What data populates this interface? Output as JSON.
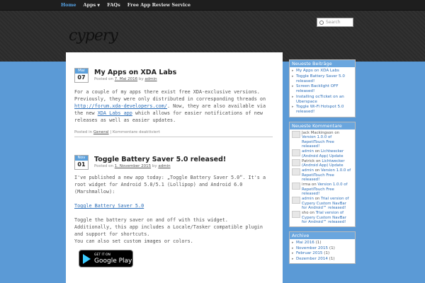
{
  "nav": {
    "home": "Home",
    "apps": "Apps",
    "faqs": "FAQs",
    "review": "Free App Review Service"
  },
  "header": {
    "logo": "cypery",
    "search_placeholder": "Search"
  },
  "posts": [
    {
      "month": "Mai",
      "day": "07",
      "title": "My Apps on XDA Labs",
      "meta_prefix": "Posted on",
      "date": "7. Mai 2016",
      "by": "by",
      "author": "admin",
      "body_1": "For a couple of my apps there exist free XDA-exclusive versions. Previously, they were only distributed in corresponding threads on",
      "link_1": "http://forum.xda-developers.com/",
      "body_2": ". Now, they are also available via the new",
      "link_2": "XDA Labs app",
      "body_3": "which allows for easier notifications of new releases as well as easier updates.",
      "footer_prefix": "Posted in",
      "category": "General",
      "footer_sep": "|",
      "comments": "Kommentare deaktiviert"
    },
    {
      "month": "Nov",
      "day": "01",
      "title": "Toggle Battery Saver 5.0 released!",
      "meta_prefix": "Posted on",
      "date": "1. November 2015",
      "by": "by",
      "author": "admin",
      "para_1": "I've published a new app today: „Toggle Battery Saver 5.0“. It's a root widget for Android 5.0/5.1 (Lollipop) and Android 6.0 (Marshmallow):",
      "link": "Toggle Battery Saver 5.0",
      "para_2a": "Toggle the battery saver on and off with this widget.",
      "para_2b": "Additionally, this app includes a Locale/Tasker compatible plugin and support for shortcuts.",
      "para_2c": "You can also set custom images or colors.",
      "badge_small": "GET IT ON",
      "badge_big": "Google Play"
    }
  ],
  "sidebar": {
    "recent_title": "Neueste Beiträge",
    "recent": [
      "My Apps on XDA Labs",
      "Toggle Battery Saver 5.0 released!",
      "Screen Backlight OFF released!",
      "Installing ocTicket on an Uberspace",
      "Toggle Wi-Fi Hotspot 5.0 released!"
    ],
    "comments_title": "Neueste Kommentare",
    "comments": [
      {
        "author": "Jack Mackingson",
        "on": "on",
        "post": "Version 1.0.0 of RepetiTouch Free released!"
      },
      {
        "author": "admin",
        "on": "on",
        "post": "Lichtwecker (Android App) Update"
      },
      {
        "author": "Patrick",
        "on": "on",
        "post": "Lichtwecker (Android App) Update"
      },
      {
        "author": "admin",
        "on": "on",
        "post": "Version 1.0.0 of RepetiTouch Free released!"
      },
      {
        "author": "irma",
        "on": "on",
        "post": "Version 1.0.0 of RepetiTouch Free released!"
      },
      {
        "author": "admin",
        "on": "on",
        "post": "Trial version of Cypery Custom NavBar for Android™ released!"
      },
      {
        "author": "sho",
        "on": "on",
        "post": "Trial version of Cypery Custom NavBar for Android™ released!"
      }
    ],
    "archive_title": "Archive",
    "archive": [
      {
        "label": "Mai 2016",
        "count": "(1)"
      },
      {
        "label": "November 2015",
        "count": "(1)"
      },
      {
        "label": "Februar 2015",
        "count": "(1)"
      },
      {
        "label": "Dezember 2014",
        "count": "(1)"
      }
    ]
  },
  "colors": {
    "accent": "#5b9ad6",
    "link": "#2a6db8",
    "nav_active": "#55a3e6"
  }
}
